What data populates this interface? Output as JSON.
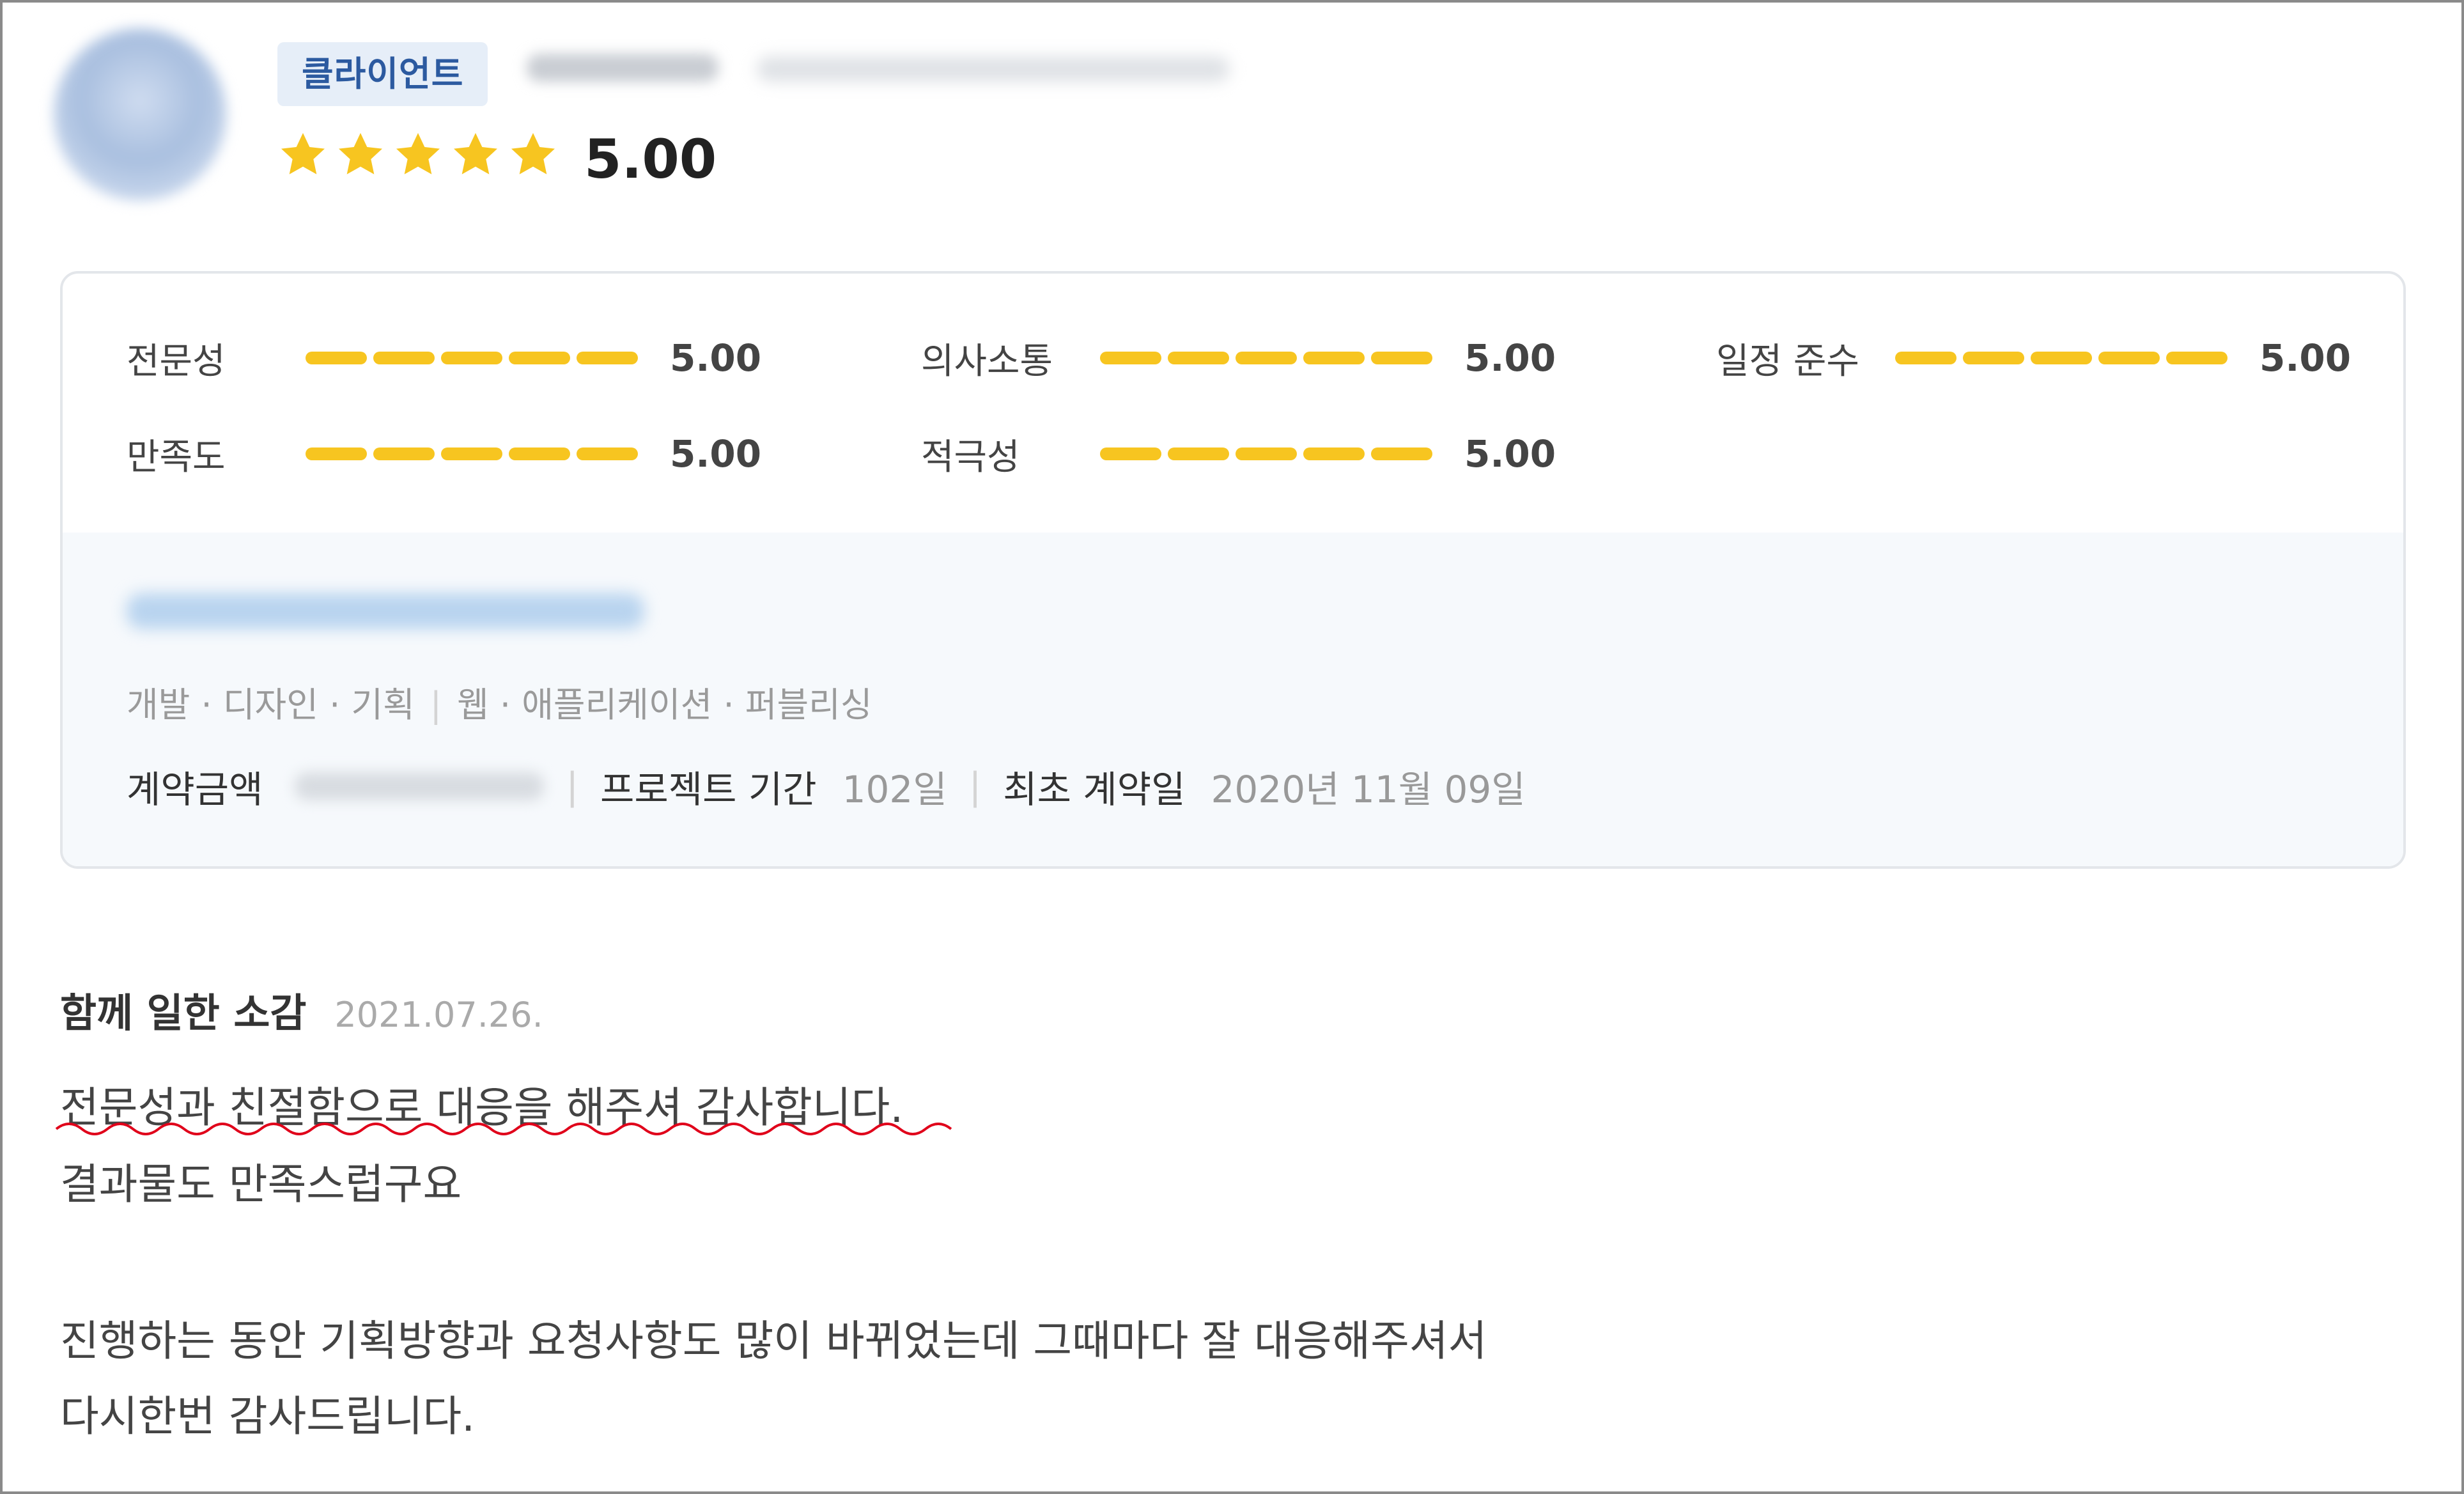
{
  "header": {
    "role_badge": "클라이언트",
    "rating": {
      "stars": 5,
      "max_stars": 5,
      "score": "5.00"
    }
  },
  "metrics": [
    {
      "label": "전문성",
      "value": "5.00",
      "fraction": 1.0
    },
    {
      "label": "의사소통",
      "value": "5.00",
      "fraction": 1.0
    },
    {
      "label": "일정 준수",
      "value": "5.00",
      "fraction": 1.0
    },
    {
      "label": "만족도",
      "value": "5.00",
      "fraction": 1.0
    },
    {
      "label": "적극성",
      "value": "5.00",
      "fraction": 1.0
    }
  ],
  "project": {
    "categories": {
      "fields": [
        "개발",
        "디자인",
        "기획"
      ],
      "types": [
        "웹",
        "애플리케이션",
        "퍼블리싱"
      ]
    },
    "contract": {
      "amount_label": "계약금액",
      "period_label": "프로젝트 기간",
      "period_value": "102일",
      "first_contract_label": "최초 계약일",
      "first_contract_value": "2020년 11월 09일"
    }
  },
  "review": {
    "title": "함께 일한 소감",
    "date": "2021.07.26.",
    "lines": [
      "전문성과 친절함으로 대응을 해주셔 감사합니다.",
      "결과물도 만족스럽구요",
      "",
      "진행하는 동안 기획방향과 요청사항도 많이 바뀌었는데 그때마다 잘 대응해주셔서",
      "다시한번 감사드립니다."
    ]
  },
  "colors": {
    "star": "#f7c520",
    "bar": "#f7c520",
    "badge_bg": "#e6eef8",
    "badge_text": "#2c5aa0",
    "spellcheck_underline": "#e0001a"
  }
}
